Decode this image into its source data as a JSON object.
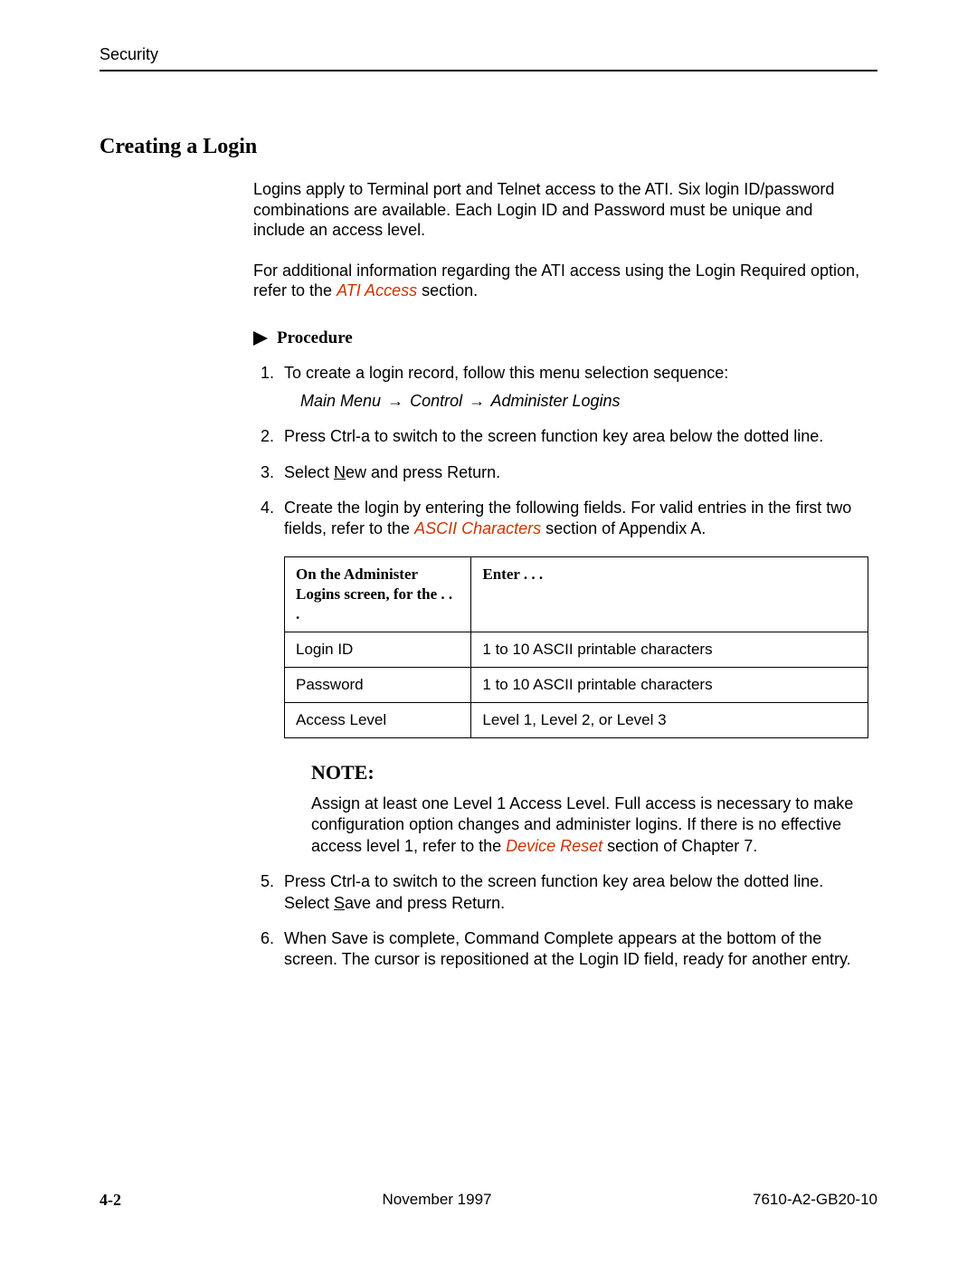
{
  "header": {
    "section": "Security"
  },
  "title": "Creating a Login",
  "intro1": "Logins apply to Terminal port and Telnet access to the ATI. Six login ID/password combinations are available. Each Login ID and Password must be unique and include an access level.",
  "intro2_a": "For additional information regarding the ATI access using the Login Required option, refer to the ",
  "intro2_link": "ATI Access",
  "intro2_b": " section.",
  "procedure_label": "Procedure",
  "step1": "To create a login record, follow this menu selection sequence:",
  "menu_path": {
    "a": "Main Menu",
    "b": "Control",
    "c": "Administer Logins",
    "arrow": "→"
  },
  "step2": "Press Ctrl-a to switch to the screen function key area below the dotted line.",
  "step3_a": "Select ",
  "step3_key": "N",
  "step3_b": "ew and press Return.",
  "step4_a": "Create the login by entering the following fields. For valid entries in the first two fields, refer to the ",
  "step4_link": "ASCII Characters",
  "step4_b": " section of Appendix A.",
  "table": {
    "h1": "On the Administer Logins screen, for the . . .",
    "h2": "Enter . . .",
    "rows": [
      {
        "c1": "Login ID",
        "c2": "1 to 10 ASCII printable characters"
      },
      {
        "c1": "Password",
        "c2": "1 to 10 ASCII printable characters"
      },
      {
        "c1": "Access Level",
        "c2": "Level 1, Level 2, or Level 3"
      }
    ]
  },
  "note": {
    "title": "NOTE:",
    "body_a": "Assign at least one Level 1 Access Level. Full access is necessary to make configuration option changes and administer logins. If there is no effective access level 1, refer to the ",
    "link": "Device Reset",
    "body_b": " section of Chapter 7."
  },
  "step5_a": "Press Ctrl-a to switch to the screen function key area below the dotted line. Select ",
  "step5_key": "S",
  "step5_b": "ave and press Return.",
  "step6": "When Save is complete, Command Complete appears at the bottom of the screen. The cursor is repositioned at the Login ID field, ready for another entry.",
  "footer": {
    "page": "4-2",
    "date": "November 1997",
    "docid": "7610-A2-GB20-10"
  }
}
